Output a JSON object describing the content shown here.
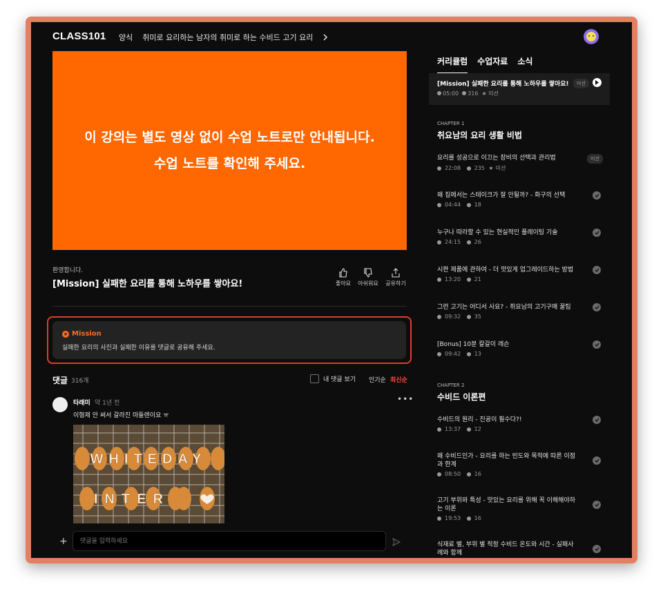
{
  "header": {
    "logo": "CLASS101",
    "crumb_category": "양식",
    "crumb_course": "취미로 요리하는 남자의 취미로 하는 수비드 고기 요리"
  },
  "video": {
    "line1": "이 강의는 별도 영상 없이 수업 노트로만 안내됩니다.",
    "line2": "수업 노트를 확인해 주세요."
  },
  "lesson": {
    "welcome": "환영합니다.",
    "title": "[Mission] 실패한 요리를 통해 노하우를 쌓아요!"
  },
  "actions": {
    "like": "좋아요",
    "dislike": "아쉬워요",
    "share": "공유하기"
  },
  "mission": {
    "label": "Mission",
    "text": "실패한 요리의 사진과 실패한 이유를 댓글로 공유해 주세요."
  },
  "comments": {
    "title": "댓글",
    "count": "316개",
    "mine": "내 댓글 보기",
    "sort_popular": "인기순",
    "sort_latest": "최신순",
    "input_placeholder": "댓글을 입력하세요",
    "first": {
      "author": "타래미",
      "time": "약 1년 전",
      "text": "이형제 안 써서 갈라진 마들렌이요 ㅠ",
      "image_text_top": "WHITEDAY",
      "image_text_bottom": "INTER"
    }
  },
  "panel": {
    "tabs": [
      "커리큘럼",
      "수업자료",
      "소식"
    ],
    "current": {
      "title": "[Mission] 실패한 요리를 통해 노하우를 쌓아요!",
      "badge": "미션",
      "duration": "05:00",
      "comments": "316",
      "tag": "미션"
    },
    "chapters": [
      {
        "label": "CHAPTER 1",
        "title": "취요남의 요리 생활 비법",
        "lessons": [
          {
            "title": "요리를 성공으로 이끄는 장비의 선택과 관리법",
            "duration": "22:08",
            "comments": "235",
            "tag": "미션",
            "badge": "미션"
          },
          {
            "title": "왜 집에서는 스테이크가 잘 안될까? - 화구의 선택",
            "duration": "04:44",
            "comments": "18"
          },
          {
            "title": "누구나 따라할 수 있는 현실적인 플레이팅 기술",
            "duration": "24:15",
            "comments": "26"
          },
          {
            "title": "시판 제품에 관하여 - 더 맛있게 업그레이드하는 방법",
            "duration": "13:20",
            "comments": "21"
          },
          {
            "title": "그런 고기는 어디서 사요? - 취요남의 고기구매 꿀팁",
            "duration": "09:32",
            "comments": "35"
          },
          {
            "title": "[Bonus] 10분 칼갈이 레슨",
            "duration": "09:42",
            "comments": "13"
          }
        ]
      },
      {
        "label": "CHAPTER 2",
        "title": "수비드 이론편",
        "lessons": [
          {
            "title": "수비드의 원리 - 진공이 필수다?!",
            "duration": "13:37",
            "comments": "12"
          },
          {
            "title": "왜 수비드인가 - 요리를 하는 빈도와 목적에 따른 이점과 한계",
            "duration": "08:50",
            "comments": "16"
          },
          {
            "title": "고기 부위와 특성 - 맛있는 요리를 위해 꼭 이해해야하는 이론",
            "duration": "19:53",
            "comments": "16"
          },
          {
            "title": "식재료 별, 부위 별 적정 수비드 온도와 시간 - 실패사례와 함께"
          }
        ]
      }
    ]
  }
}
